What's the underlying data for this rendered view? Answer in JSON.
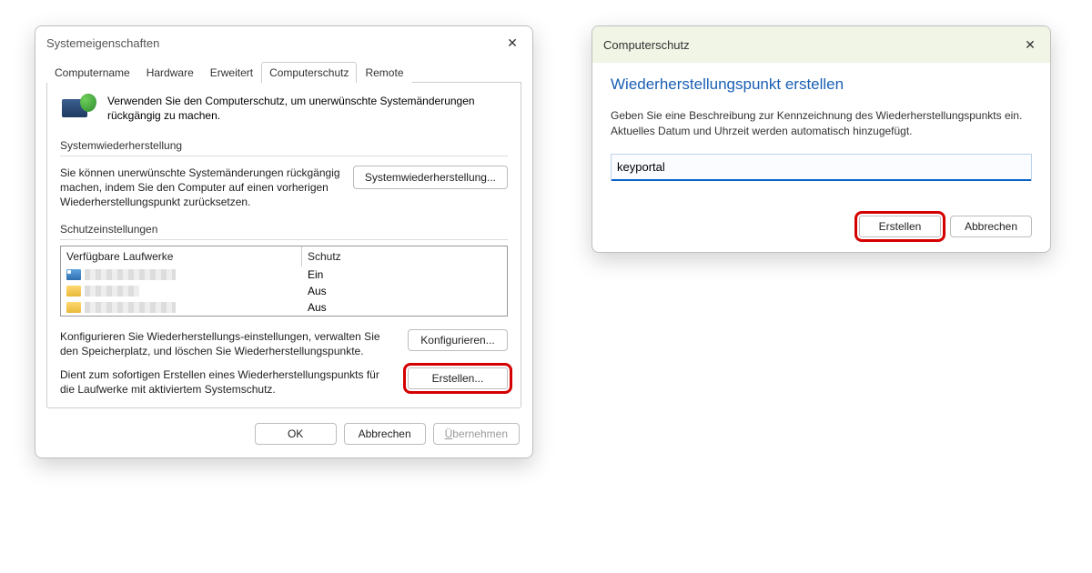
{
  "dialog1": {
    "title": "Systemeigenschaften",
    "tabs": {
      "computername": "Computername",
      "hardware": "Hardware",
      "erweitert": "Erweitert",
      "computerschutz": "Computerschutz",
      "remote": "Remote"
    },
    "intro": "Verwenden Sie den Computerschutz, um unerwünschte Systemänderungen rückgängig zu machen.",
    "restore_section_label": "Systemwiederherstellung",
    "restore_text": "Sie können unerwünschte Systemänderungen rückgängig machen, indem Sie den Computer auf einen vorherigen Wiederherstellungspunkt zurücksetzen.",
    "restore_button": "Systemwiederherstellung...",
    "protection_section_label": "Schutzeinstellungen",
    "table": {
      "col_drives": "Verfügbare Laufwerke",
      "col_protection": "Schutz",
      "rows": [
        {
          "protection": "Ein",
          "icon": "system"
        },
        {
          "protection": "Aus",
          "icon": "folder"
        },
        {
          "protection": "Aus",
          "icon": "folder"
        }
      ]
    },
    "configure_text": "Konfigurieren Sie Wiederherstellungs-einstellungen, verwalten Sie den Speicherplatz, und löschen Sie Wiederherstellungspunkte.",
    "configure_button": "Konfigurieren...",
    "create_text": "Dient zum sofortigen Erstellen eines Wiederherstellungspunkts für die Laufwerke mit aktiviertem Systemschutz.",
    "create_button": "Erstellen...",
    "footer": {
      "ok": "OK",
      "cancel": "Abbrechen",
      "apply_pre": "Ü",
      "apply_rest": "bernehmen"
    }
  },
  "dialog2": {
    "title": "Computerschutz",
    "heading": "Wiederherstellungspunkt erstellen",
    "desc": "Geben Sie eine Beschreibung zur Kennzeichnung des Wiederherstellungspunkts ein. Aktuelles Datum und Uhrzeit werden automatisch hinzugefügt.",
    "input_value": "keyportal",
    "create": "Erstellen",
    "cancel": "Abbrechen"
  }
}
